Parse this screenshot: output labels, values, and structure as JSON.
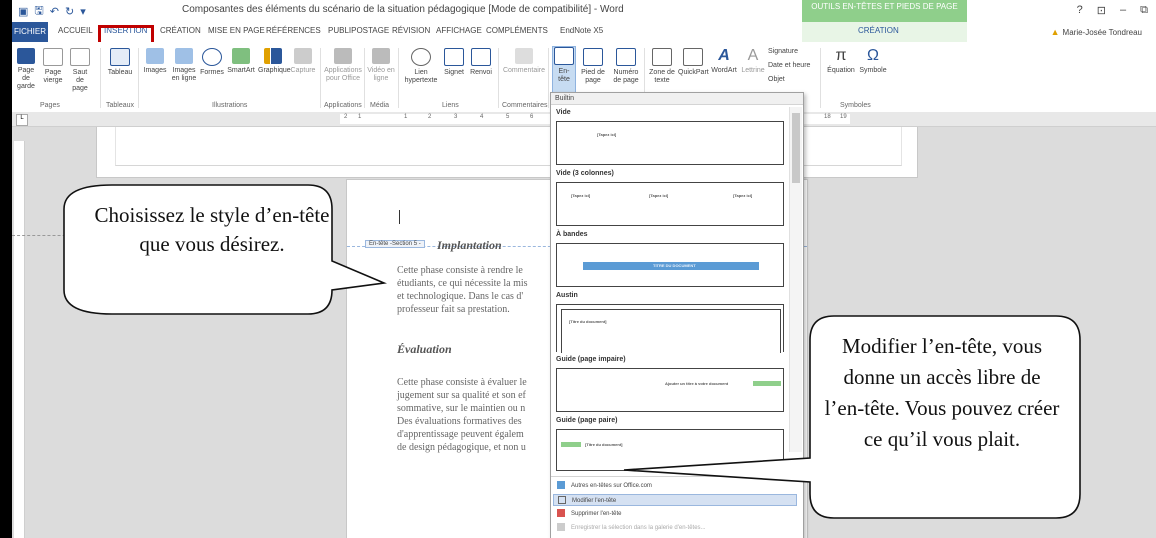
{
  "window": {
    "title": "Composantes des éléments du scénario de la situation pédagogique [Mode de compatibilité] - Word",
    "context_tab_group": "OUTILS EN-TÊTES ET PIEDS DE PAGE",
    "user": "Marie-Josée Tondreau",
    "controls": [
      "?",
      "⊡",
      "–",
      "⧉"
    ]
  },
  "tabs": [
    {
      "label": "FICHIER"
    },
    {
      "label": "ACCUEIL"
    },
    {
      "label": "INSERTION"
    },
    {
      "label": "CRÉATION"
    },
    {
      "label": "MISE EN PAGE"
    },
    {
      "label": "RÉFÉRENCES"
    },
    {
      "label": "PUBLIPOSTAGE"
    },
    {
      "label": "RÉVISION"
    },
    {
      "label": "AFFICHAGE"
    },
    {
      "label": "COMPLÉMENTS"
    },
    {
      "label": "EndNote X5"
    },
    {
      "label": "CRÉATION"
    }
  ],
  "ribbon": {
    "buttons": [
      {
        "label": "Page de garde"
      },
      {
        "label": "Page vierge"
      },
      {
        "label": "Saut de page"
      },
      {
        "label": "Tableau"
      },
      {
        "label": "Images"
      },
      {
        "label": "Images en ligne"
      },
      {
        "label": "Formes"
      },
      {
        "label": "SmartArt"
      },
      {
        "label": "Graphique"
      },
      {
        "label": "Capture"
      },
      {
        "label": "Applications pour Office"
      },
      {
        "label": "Vidéo en ligne"
      },
      {
        "label": "Lien hypertexte"
      },
      {
        "label": "Signet"
      },
      {
        "label": "Renvoi"
      },
      {
        "label": "Commentaire"
      },
      {
        "label": "En-tête"
      },
      {
        "label": "Pied de page"
      },
      {
        "label": "Numéro de page"
      },
      {
        "label": "Zone de texte"
      },
      {
        "label": "QuickPart"
      },
      {
        "label": "WordArt"
      },
      {
        "label": "Lettrine"
      },
      {
        "label": "Équation"
      },
      {
        "label": "Symbole"
      }
    ],
    "side_items": [
      "Signature",
      "Date et heure",
      "Objet"
    ],
    "groups": [
      "Pages",
      "Tableaux",
      "Illustrations",
      "Applications",
      "Média",
      "Liens",
      "Commentaires",
      "Symboles"
    ]
  },
  "ruler": {
    "ticks": [
      "2",
      "1",
      "1",
      "2",
      "3",
      "4",
      "5",
      "6",
      "18",
      "19"
    ]
  },
  "document": {
    "section_tag": "En-tête -Section 5 -",
    "heading1": "Implantation",
    "para1": "Cette phase consiste à rendre le\nétudiants, ce qui nécessite la mis\net technologique. Dans le cas d'\nprofesseur fait sa prestation.",
    "heading2": "Évaluation",
    "para2": "Cette phase consiste à évaluer le\njugement sur sa qualité et son ef\nsommative, sur le maintien ou n\nDes évaluations formatives des \nd'apprentissage peuvent égalem\nde design pédagogique, et non u"
  },
  "gallery": {
    "header": "Builtin",
    "sections": [
      {
        "label": "Vide",
        "placeholders": [
          "[Tapez ici]"
        ]
      },
      {
        "label": "Vide (3 colonnes)",
        "placeholders": [
          "[Tapez ici]",
          "[Tapez ici]",
          "[Tapez ici]"
        ]
      },
      {
        "label": "À bandes",
        "placeholders": [
          "TITRE DU DOCUMENT"
        ]
      },
      {
        "label": "Austin",
        "placeholders": [
          "[Titre du document]"
        ]
      },
      {
        "label": "Guide (page impaire)",
        "placeholders": [
          "Ajouter un titre à votre document"
        ]
      },
      {
        "label": "Guide (page paire)",
        "placeholders": [
          "[Titre du document]"
        ]
      }
    ],
    "actions": [
      {
        "label": "Autres en-têtes sur Office.com"
      },
      {
        "label": "Modifier l'en-tête"
      },
      {
        "label": "Supprimer l'en-tête"
      },
      {
        "label": "Enregistrer la sélection dans la galerie d'en-têtes..."
      }
    ]
  },
  "callouts": {
    "left": "Choisissez le style d’en-tête que vous désirez.",
    "right": "Modifier l’en-tête, vous donne un accès libre de l’en-tête. Vous pouvez créer ce qu’il vous plait."
  },
  "colors": {
    "word_blue": "#2b579a",
    "context_green": "#8fcf8b",
    "highlight_red": "#c00000",
    "band_blue": "#5b9bd5"
  }
}
